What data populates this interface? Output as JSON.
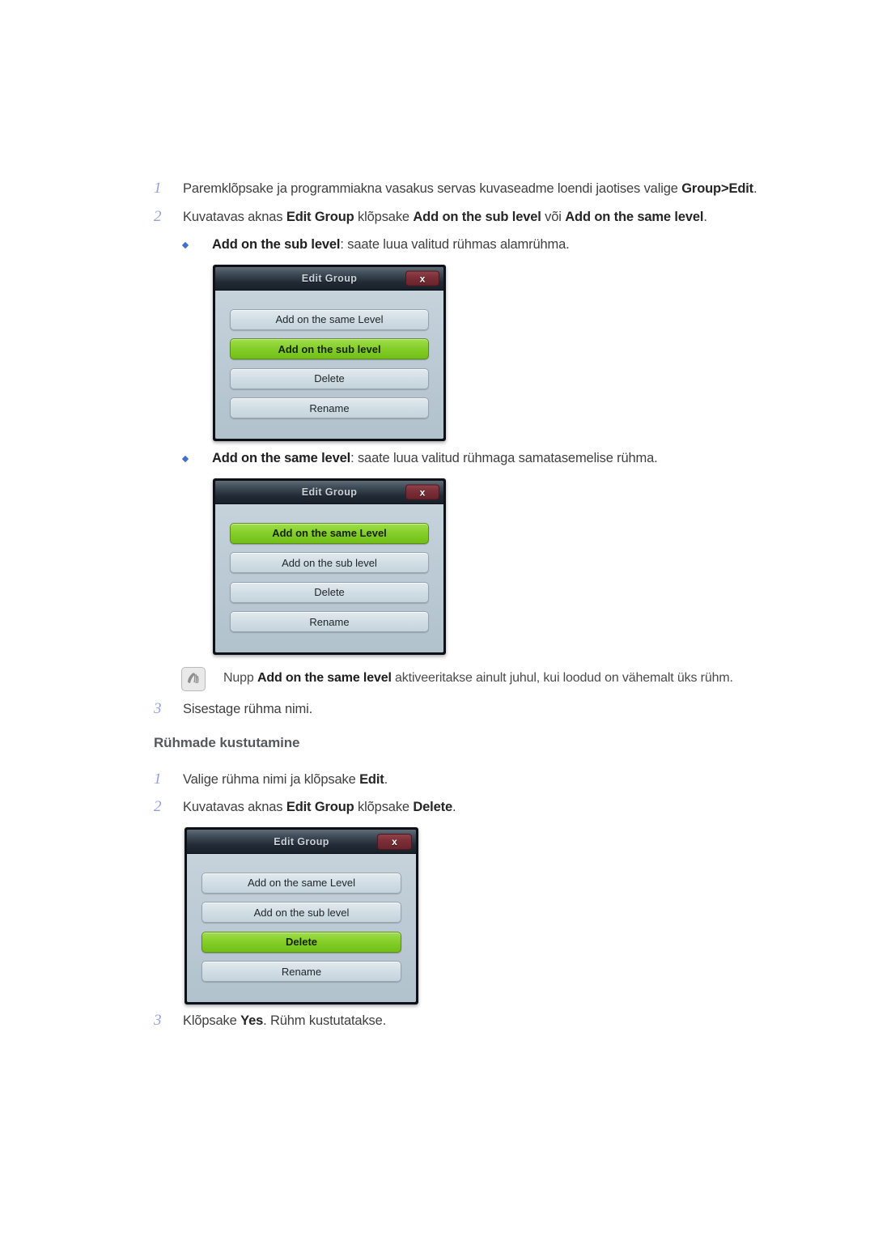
{
  "steps_top": [
    {
      "num": "1",
      "parts": [
        {
          "t": "Paremklõpsake ja programmiakna vasakus servas kuvaseadme loendi jaotises valige ",
          "b": false
        },
        {
          "t": "Group>Edit",
          "b": true
        },
        {
          "t": ".",
          "b": false
        }
      ]
    },
    {
      "num": "2",
      "parts": [
        {
          "t": "Kuvatavas aknas ",
          "b": false
        },
        {
          "t": "Edit Group",
          "b": true
        },
        {
          "t": " klõpsake ",
          "b": false
        },
        {
          "t": "Add on the sub level",
          "b": true
        },
        {
          "t": " või ",
          "b": false
        },
        {
          "t": "Add on the same level",
          "b": true
        },
        {
          "t": ".",
          "b": false
        }
      ]
    }
  ],
  "bullets": [
    {
      "parts": [
        {
          "t": "Add on the sub level",
          "b": true
        },
        {
          "t": ": saate luua valitud rühmas alamrühma.",
          "b": false
        }
      ]
    },
    {
      "parts": [
        {
          "t": "Add on the same level",
          "b": true
        },
        {
          "t": ": saate luua valitud rühmaga samatasemelise rühma.",
          "b": false
        }
      ]
    }
  ],
  "note": {
    "icon": "note-hand-icon",
    "parts": [
      {
        "t": "Nupp ",
        "b": false
      },
      {
        "t": "Add on the same level",
        "b": true
      },
      {
        "t": " aktiveeritakse ainult juhul, kui loodud on vähemalt üks rühm.",
        "b": false
      }
    ]
  },
  "step3_top": {
    "num": "3",
    "parts": [
      {
        "t": "Sisestage rühma nimi.",
        "b": false
      }
    ]
  },
  "section_heading": "Rühmade kustutamine",
  "steps_delete": [
    {
      "num": "1",
      "parts": [
        {
          "t": "Valige rühma nimi ja klõpsake ",
          "b": false
        },
        {
          "t": "Edit",
          "b": true
        },
        {
          "t": ".",
          "b": false
        }
      ]
    },
    {
      "num": "2",
      "parts": [
        {
          "t": "Kuvatavas aknas ",
          "b": false
        },
        {
          "t": "Edit Group",
          "b": true
        },
        {
          "t": " klõpsake ",
          "b": false
        },
        {
          "t": "Delete",
          "b": true
        },
        {
          "t": ".",
          "b": false
        }
      ]
    },
    {
      "num": "3",
      "parts": [
        {
          "t": "Klõpsake ",
          "b": false
        },
        {
          "t": "Yes",
          "b": true
        },
        {
          "t": ". Rühm kustutatakse.",
          "b": false
        }
      ]
    }
  ],
  "dialogs": [
    {
      "title": "Edit Group",
      "close_label": "x",
      "buttons": [
        {
          "label": "Add on the same Level",
          "selected": false
        },
        {
          "label": "Add on the sub level",
          "selected": true
        },
        {
          "label": "Delete",
          "selected": false
        },
        {
          "label": "Rename",
          "selected": false
        }
      ]
    },
    {
      "title": "Edit Group",
      "close_label": "x",
      "buttons": [
        {
          "label": "Add on the same Level",
          "selected": true
        },
        {
          "label": "Add on the sub level",
          "selected": false
        },
        {
          "label": "Delete",
          "selected": false
        },
        {
          "label": "Rename",
          "selected": false
        }
      ]
    },
    {
      "title": "Edit Group",
      "close_label": "x",
      "buttons": [
        {
          "label": "Add on the same Level",
          "selected": false
        },
        {
          "label": "Add on the sub level",
          "selected": false
        },
        {
          "label": "Delete",
          "selected": true
        },
        {
          "label": "Rename",
          "selected": false
        }
      ]
    }
  ],
  "colors": {
    "step_number": "#92a2e0",
    "bullet": "#3f6fd0",
    "selected_button_green": "#86cf2b",
    "close_button_red": "#7c2f38",
    "dialog_titlebar": "#232c36",
    "dialog_body": "#bdcbd5",
    "body_text": "#3f3f3f",
    "heading_text": "#55595c"
  }
}
